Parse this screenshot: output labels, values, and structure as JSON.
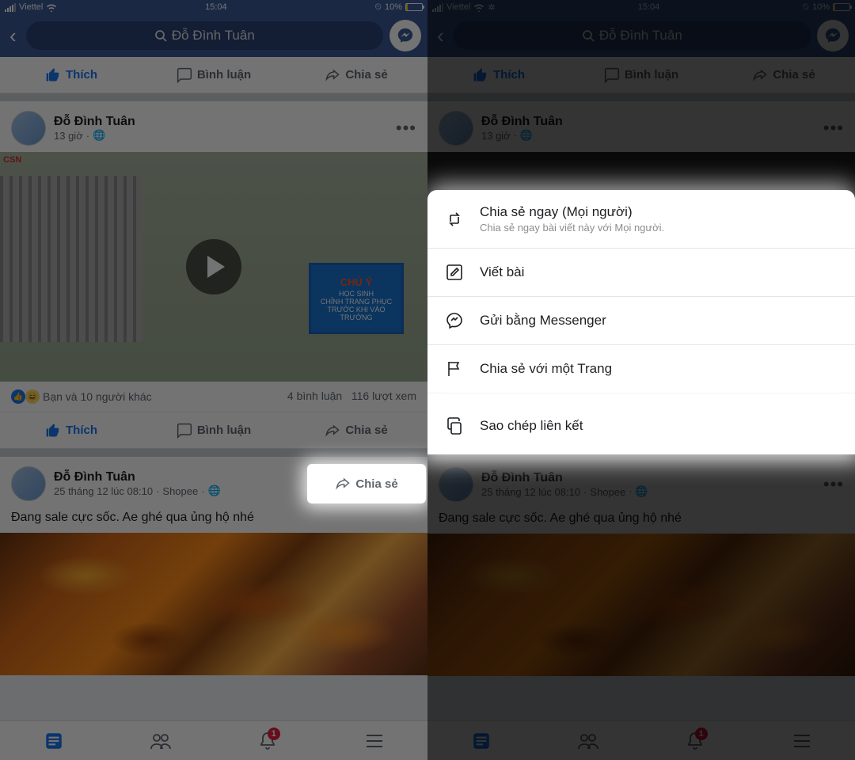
{
  "status": {
    "carrier": "Viettel",
    "time": "15:04",
    "battery_pct": "10%"
  },
  "header": {
    "search_text": "Đỗ Đình Tuân"
  },
  "actions": {
    "like": "Thích",
    "comment": "Bình luận",
    "share": "Chia sẻ"
  },
  "post1": {
    "author": "Đỗ Đình Tuân",
    "time": "13 giờ",
    "sign_title": "CHÚ Ý",
    "sign_line1": "HỌC SINH",
    "sign_line2": "CHỈNH TRANG PHỤC",
    "sign_line3": "TRƯỚC KHI VÀO TRƯỜNG",
    "csn_tag": "CSN",
    "reactions_text": "Bạn và 10 người khác",
    "comments": "4 bình luận",
    "views": "116 lượt xem"
  },
  "post2": {
    "author": "Đỗ Đình Tuân",
    "time": "25 tháng 12 lúc 08:10",
    "via": "Shopee",
    "text": "Đang sale cực sốc. Ae ghé qua ủng hộ nhé"
  },
  "tabbar": {
    "notif_badge": "1"
  },
  "share_sheet": {
    "share_now_title": "Chia sẻ ngay (Mọi người)",
    "share_now_sub": "Chia sẻ ngay bài viết này với Mọi người.",
    "write_post": "Viết bài",
    "send_messenger": "Gửi bằng Messenger",
    "share_page": "Chia sẻ với một Trang",
    "copy_link": "Sao chép liên kết"
  }
}
